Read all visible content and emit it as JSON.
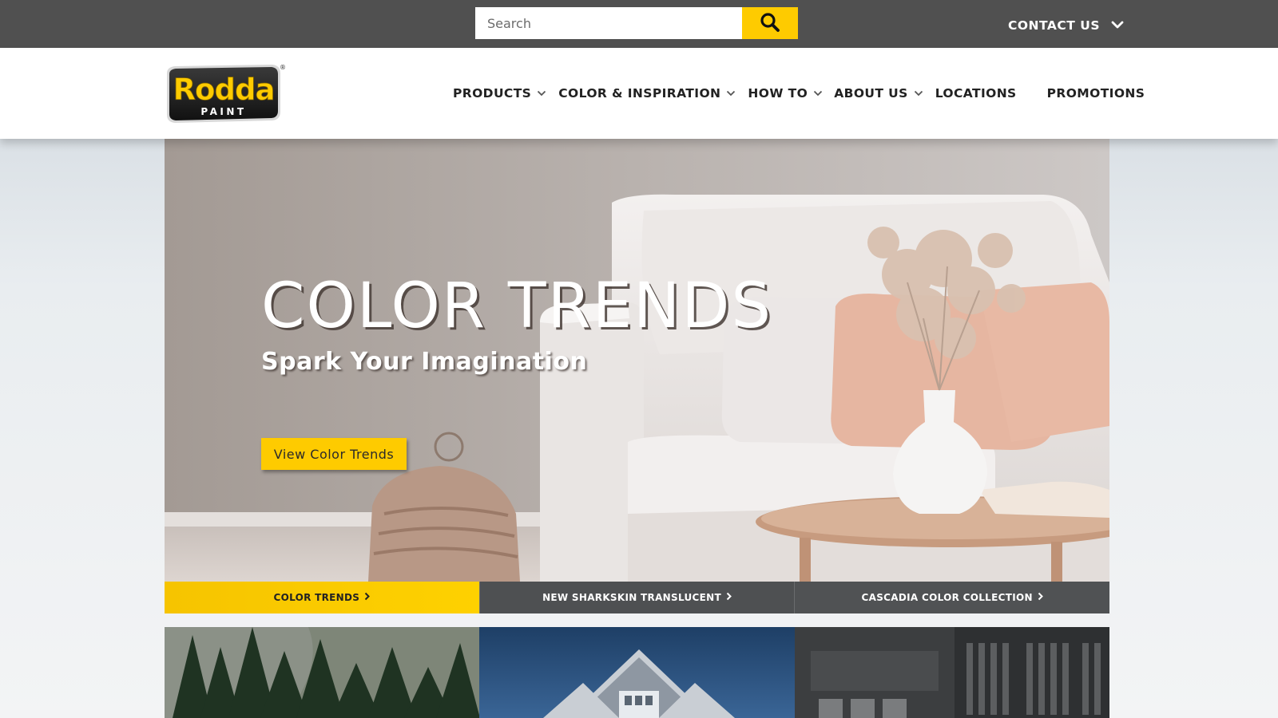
{
  "topbar": {
    "search_placeholder": "Search",
    "contact_label": "CONTACT US"
  },
  "brand": {
    "name": "Rodda",
    "tagline": "PAINT",
    "registered": "®"
  },
  "nav": {
    "items": [
      {
        "label": "PRODUCTS",
        "has_dropdown": true
      },
      {
        "label": "COLOR & INSPIRATION",
        "has_dropdown": true
      },
      {
        "label": "HOW TO",
        "has_dropdown": true
      },
      {
        "label": "ABOUT US",
        "has_dropdown": true
      },
      {
        "label": "LOCATIONS",
        "has_dropdown": false
      },
      {
        "label": "PROMOTIONS",
        "has_dropdown": false
      }
    ]
  },
  "hero": {
    "title": "COLOR TRENDS",
    "subtitle": "Spark Your Imagination",
    "cta_label": "View Color Trends"
  },
  "tabs": [
    {
      "label": "COLOR TRENDS",
      "active": true
    },
    {
      "label": "NEW SHARKSKIN TRANSLUCENT",
      "active": false
    },
    {
      "label": "CASCADIA COLOR COLLECTION",
      "active": false
    }
  ],
  "tiles": [
    {
      "name": "forest-tile"
    },
    {
      "name": "house-tile"
    },
    {
      "name": "store-tile"
    }
  ],
  "colors": {
    "accent": "#fecb00",
    "topbar": "#505050",
    "tab_inactive": "#4e5052"
  },
  "icons": {
    "search": "search-icon",
    "chevron": "chevron-down-icon",
    "arrow": "chevron-right-icon"
  }
}
